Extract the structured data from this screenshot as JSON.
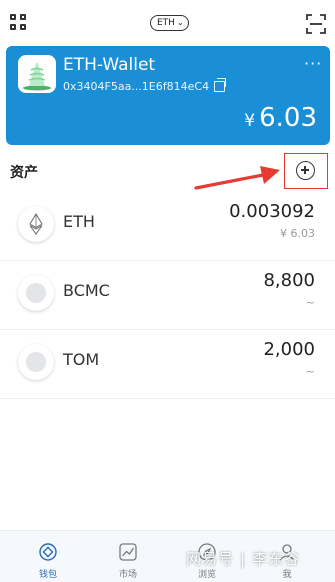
{
  "header": {
    "network_label": "ETH",
    "icons": [
      "grid-icon",
      "chevron-down-icon",
      "scan-icon"
    ]
  },
  "wallet": {
    "name": "ETH-Wallet",
    "address": "0x3404F5aa...1E6f814eC4",
    "currency_symbol": "¥",
    "balance": "6.03",
    "more": "···"
  },
  "assets": {
    "title": "资产",
    "items": [
      {
        "name": "ETH",
        "amount": "0.003092",
        "value": "¥ 6.03",
        "icon": "eth-icon"
      },
      {
        "name": "BCMC",
        "amount": "8,800",
        "value": "~",
        "icon": "token-placeholder-icon"
      },
      {
        "name": "TOM",
        "amount": "2,000",
        "value": "~",
        "icon": "token-placeholder-icon"
      }
    ]
  },
  "nav": {
    "items": [
      {
        "label": "钱包",
        "active": true
      },
      {
        "label": "市场",
        "active": false
      },
      {
        "label": "浏览",
        "active": false
      },
      {
        "label": "我",
        "active": false
      }
    ]
  },
  "watermark": {
    "source": "网易号",
    "author": "李东谷"
  },
  "colors": {
    "card": "#1a8fd6",
    "annotation": "#e63a32",
    "nav_active": "#2a6ab8"
  }
}
